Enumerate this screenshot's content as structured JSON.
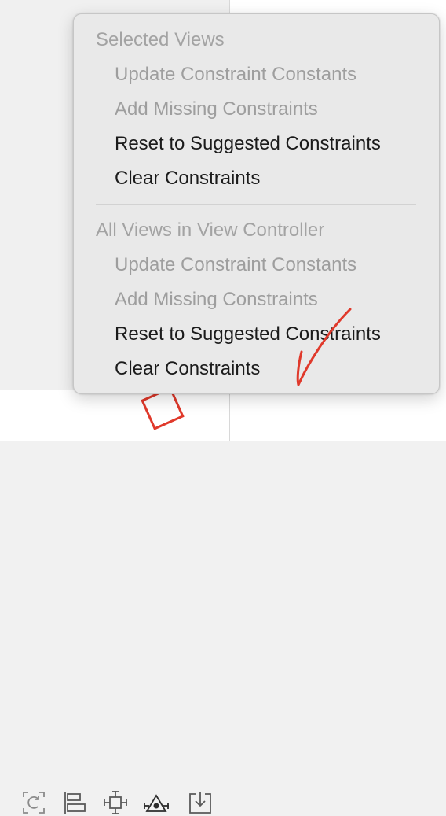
{
  "menu": {
    "selected_header": "Selected Views",
    "selected_items": [
      {
        "label": "Update Constraint Constants",
        "enabled": false
      },
      {
        "label": "Add Missing Constraints",
        "enabled": false
      },
      {
        "label": "Reset to Suggested Constraints",
        "enabled": true
      },
      {
        "label": "Clear Constraints",
        "enabled": true
      }
    ],
    "all_header": "All Views in View Controller",
    "all_items": [
      {
        "label": "Update Constraint Constants",
        "enabled": false
      },
      {
        "label": "Add Missing Constraints",
        "enabled": false
      },
      {
        "label": "Reset to Suggested Constraints",
        "enabled": true
      },
      {
        "label": "Clear Constraints",
        "enabled": true
      }
    ]
  },
  "toolbar": {
    "icons": [
      "update-frames-icon",
      "align-icon",
      "add-constraints-icon",
      "resolve-auto-layout-issues-icon",
      "embed-in-icon"
    ]
  },
  "annotation": {
    "color": "#e0392b"
  }
}
